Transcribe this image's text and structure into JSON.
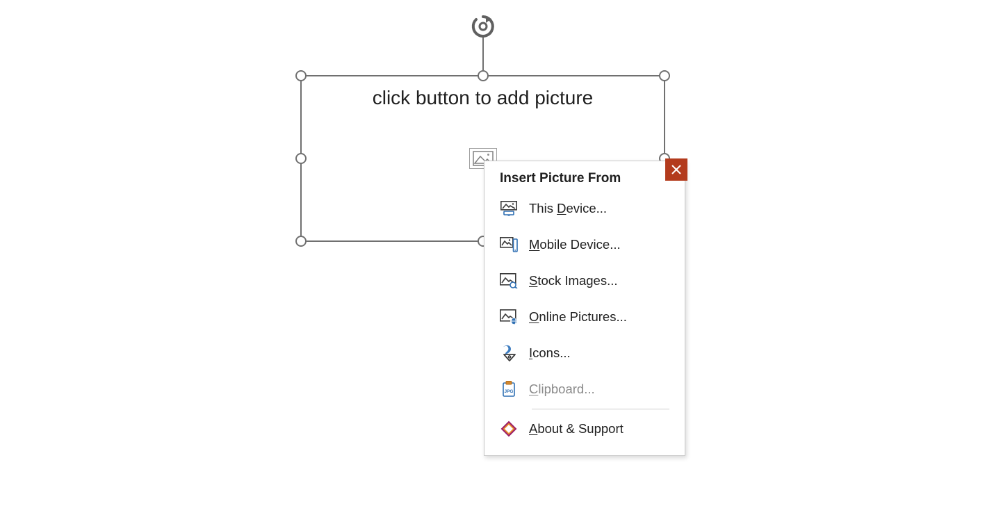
{
  "placeholder": {
    "prompt": "click button to add picture"
  },
  "popup": {
    "title": "Insert Picture From",
    "items": [
      {
        "id": "this-device",
        "pre": "This ",
        "ak": "D",
        "post": "evice...",
        "disabled": false
      },
      {
        "id": "mobile-device",
        "pre": "",
        "ak": "M",
        "post": "obile Device...",
        "disabled": false
      },
      {
        "id": "stock-images",
        "pre": "",
        "ak": "S",
        "post": "tock Images...",
        "disabled": false
      },
      {
        "id": "online-pictures",
        "pre": "",
        "ak": "O",
        "post": "nline Pictures...",
        "disabled": false
      },
      {
        "id": "icons",
        "pre": "",
        "ak": "I",
        "post": "cons...",
        "disabled": false
      },
      {
        "id": "clipboard",
        "pre": "",
        "ak": "C",
        "post": "lipboard...",
        "disabled": true
      }
    ],
    "about": {
      "pre": "",
      "ak": "A",
      "post": "bout & Support"
    }
  }
}
